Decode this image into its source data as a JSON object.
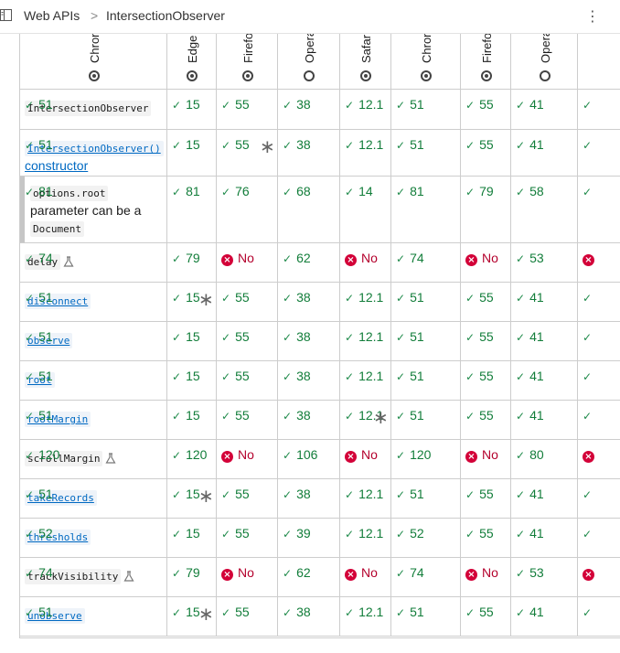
{
  "breadcrumb": {
    "root": "Web APIs",
    "separator": ">",
    "current": "IntersectionObserver"
  },
  "toolbar": {
    "menu_glyph": "⋮"
  },
  "browsers": [
    {
      "name": "Chrome",
      "icon": "chrome-icon"
    },
    {
      "name": "Edge",
      "icon": "edge-icon"
    },
    {
      "name": "Firefox",
      "icon": "firefox-icon"
    },
    {
      "name": "Opera",
      "icon": "opera-icon"
    },
    {
      "name": "Safari",
      "icon": "safari-icon"
    },
    {
      "name": "Chrome Android",
      "icon": "chrome-icon"
    },
    {
      "name": "Firefox for Android",
      "icon": "firefox-icon"
    },
    {
      "name": "Opera Android",
      "icon": "opera-icon"
    }
  ],
  "rows": [
    {
      "name": "IntersectionObserver",
      "link": false,
      "experimental": false,
      "support": [
        {
          "v": "51"
        },
        {
          "v": "15"
        },
        {
          "v": "55"
        },
        {
          "v": "38"
        },
        {
          "v": "12.1"
        },
        {
          "v": "51"
        },
        {
          "v": "55"
        },
        {
          "v": "41"
        },
        {
          "v": ""
        }
      ]
    },
    {
      "name": "IntersectionObserver()",
      "suffix": "constructor",
      "link": true,
      "experimental": false,
      "support": [
        {
          "v": "51"
        },
        {
          "v": "15"
        },
        {
          "v": "55",
          "note": true
        },
        {
          "v": "38"
        },
        {
          "v": "12.1"
        },
        {
          "v": "51"
        },
        {
          "v": "55"
        },
        {
          "v": "41"
        },
        {
          "v": ""
        }
      ]
    },
    {
      "name": "options.root",
      "desc": "parameter can be a",
      "desc_code": "Document",
      "link": false,
      "experimental": false,
      "indent": true,
      "support": [
        {
          "v": "81"
        },
        {
          "v": "81"
        },
        {
          "v": "76"
        },
        {
          "v": "68"
        },
        {
          "v": "14"
        },
        {
          "v": "81"
        },
        {
          "v": "79"
        },
        {
          "v": "58"
        },
        {
          "v": ""
        }
      ]
    },
    {
      "name": "delay",
      "link": false,
      "experimental": true,
      "support": [
        {
          "v": "74"
        },
        {
          "v": "79"
        },
        {
          "no": "No"
        },
        {
          "v": "62"
        },
        {
          "no": "No"
        },
        {
          "v": "74"
        },
        {
          "no": "No"
        },
        {
          "v": "53"
        },
        {
          "no": ""
        }
      ]
    },
    {
      "name": "disconnect",
      "link": true,
      "experimental": false,
      "support": [
        {
          "v": "51"
        },
        {
          "v": "15",
          "note": true
        },
        {
          "v": "55"
        },
        {
          "v": "38"
        },
        {
          "v": "12.1"
        },
        {
          "v": "51"
        },
        {
          "v": "55"
        },
        {
          "v": "41"
        },
        {
          "v": ""
        }
      ]
    },
    {
      "name": "observe",
      "link": true,
      "experimental": false,
      "support": [
        {
          "v": "51"
        },
        {
          "v": "15"
        },
        {
          "v": "55"
        },
        {
          "v": "38"
        },
        {
          "v": "12.1"
        },
        {
          "v": "51"
        },
        {
          "v": "55"
        },
        {
          "v": "41"
        },
        {
          "v": ""
        }
      ]
    },
    {
      "name": "root",
      "link": true,
      "experimental": false,
      "support": [
        {
          "v": "51"
        },
        {
          "v": "15"
        },
        {
          "v": "55"
        },
        {
          "v": "38"
        },
        {
          "v": "12.1"
        },
        {
          "v": "51"
        },
        {
          "v": "55"
        },
        {
          "v": "41"
        },
        {
          "v": ""
        }
      ]
    },
    {
      "name": "rootMargin",
      "link": true,
      "experimental": false,
      "support": [
        {
          "v": "51"
        },
        {
          "v": "15"
        },
        {
          "v": "55"
        },
        {
          "v": "38"
        },
        {
          "v": "12.1",
          "note": true
        },
        {
          "v": "51"
        },
        {
          "v": "55"
        },
        {
          "v": "41"
        },
        {
          "v": ""
        }
      ]
    },
    {
      "name": "scrollMargin",
      "link": false,
      "experimental": true,
      "support": [
        {
          "v": "120"
        },
        {
          "v": "120"
        },
        {
          "no": "No"
        },
        {
          "v": "106"
        },
        {
          "no": "No"
        },
        {
          "v": "120"
        },
        {
          "no": "No"
        },
        {
          "v": "80"
        },
        {
          "no": ""
        }
      ]
    },
    {
      "name": "takeRecords",
      "link": true,
      "experimental": false,
      "support": [
        {
          "v": "51"
        },
        {
          "v": "15",
          "note": true
        },
        {
          "v": "55"
        },
        {
          "v": "38"
        },
        {
          "v": "12.1"
        },
        {
          "v": "51"
        },
        {
          "v": "55"
        },
        {
          "v": "41"
        },
        {
          "v": ""
        }
      ]
    },
    {
      "name": "thresholds",
      "link": true,
      "experimental": false,
      "support": [
        {
          "v": "52"
        },
        {
          "v": "15"
        },
        {
          "v": "55"
        },
        {
          "v": "39"
        },
        {
          "v": "12.1"
        },
        {
          "v": "52"
        },
        {
          "v": "55"
        },
        {
          "v": "41"
        },
        {
          "v": ""
        }
      ]
    },
    {
      "name": "trackVisibility",
      "link": false,
      "experimental": true,
      "support": [
        {
          "v": "74"
        },
        {
          "v": "79"
        },
        {
          "no": "No"
        },
        {
          "v": "62"
        },
        {
          "no": "No"
        },
        {
          "v": "74"
        },
        {
          "no": "No"
        },
        {
          "v": "53"
        },
        {
          "no": ""
        }
      ]
    },
    {
      "name": "unobserve",
      "link": true,
      "experimental": false,
      "support": [
        {
          "v": "51"
        },
        {
          "v": "15",
          "note": true
        },
        {
          "v": "55"
        },
        {
          "v": "38"
        },
        {
          "v": "12.1"
        },
        {
          "v": "51"
        },
        {
          "v": "55"
        },
        {
          "v": "41"
        },
        {
          "v": ""
        }
      ]
    }
  ],
  "colors": {
    "supported": "#127d3a",
    "unsupported": "#d30038",
    "link": "#0069c2",
    "border": "#cdcdcd"
  }
}
